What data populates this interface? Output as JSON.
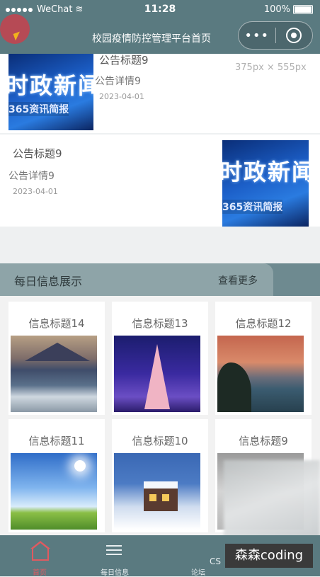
{
  "status_bar": {
    "carrier": "WeChat",
    "time": "11:28",
    "battery": "100%"
  },
  "nav": {
    "title": "校园疫情防控管理平台首页",
    "more_label": "•••"
  },
  "notices": [
    {
      "title": "公告标题9",
      "detail": "公告详情9",
      "date": "2023-04-01",
      "thumb_big": "时政新闻",
      "thumb_small": "365资讯简报"
    },
    {
      "title": "公告标题9",
      "detail": "公告详情9",
      "date": "2023-04-01",
      "thumb_big": "时政新闻",
      "thumb_small": "365资讯简报"
    }
  ],
  "image_hint": "375px × 555px",
  "section": {
    "title": "每日信息展示",
    "more": "查看更多"
  },
  "info_items": [
    {
      "title": "信息标题14",
      "image": "city-mountain"
    },
    {
      "title": "信息标题13",
      "image": "eiffel-tower"
    },
    {
      "title": "信息标题12",
      "image": "lake-sunset"
    },
    {
      "title": "信息标题11",
      "image": "blue-sky-meadow"
    },
    {
      "title": "信息标题10",
      "image": "snow-house"
    },
    {
      "title": "信息标题9",
      "image": "gray-blurred"
    }
  ],
  "tabbar": [
    {
      "label": "首页",
      "icon": "home-icon",
      "active": true
    },
    {
      "label": "每日信息",
      "icon": "list-icon",
      "active": false
    },
    {
      "label": "论坛",
      "icon": "forum-icon",
      "active": false
    }
  ],
  "overlay": {
    "cs_text": "CS",
    "watermark": "森森coding"
  },
  "colors": {
    "header": "#5a7a80",
    "section_header": "#8ea4a8",
    "active_tab": "#e05a60"
  }
}
